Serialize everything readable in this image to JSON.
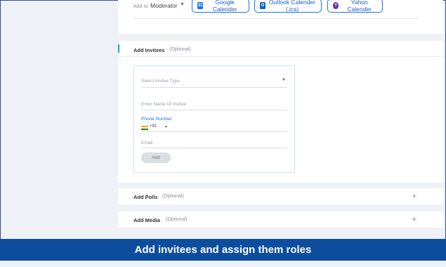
{
  "calendar_bar": {
    "add_to_label": "Add to:",
    "role_value": "Moderator",
    "google_label": "Google Calender",
    "outlook_label": "Outlook Calender (.ics)",
    "yahoo_label": "Yahoo Calender",
    "google_icon_text": "31",
    "outlook_icon_text": "O",
    "yahoo_icon_text": "Y"
  },
  "invitees": {
    "title": "Add Invitees",
    "optional": "(Optional)",
    "type_placeholder": "Select Invitee Type",
    "name_placeholder": "Enter Name Of Invitee",
    "phone_label": "Phone Number",
    "country_code": "+91",
    "email_placeholder": "Email",
    "add_button": "Add"
  },
  "polls": {
    "title": "Add Polls",
    "optional": "(Optional)"
  },
  "media": {
    "title": "Add Media",
    "optional": "(Optional)"
  },
  "banner": {
    "text": "Add invitees and assign them roles"
  },
  "colors": {
    "accent": "#1a73e8",
    "banner": "#0c4d9e",
    "background": "#eef1f6"
  },
  "icons": {
    "expand": "plus-icon",
    "dropdown": "caret-down-icon"
  }
}
